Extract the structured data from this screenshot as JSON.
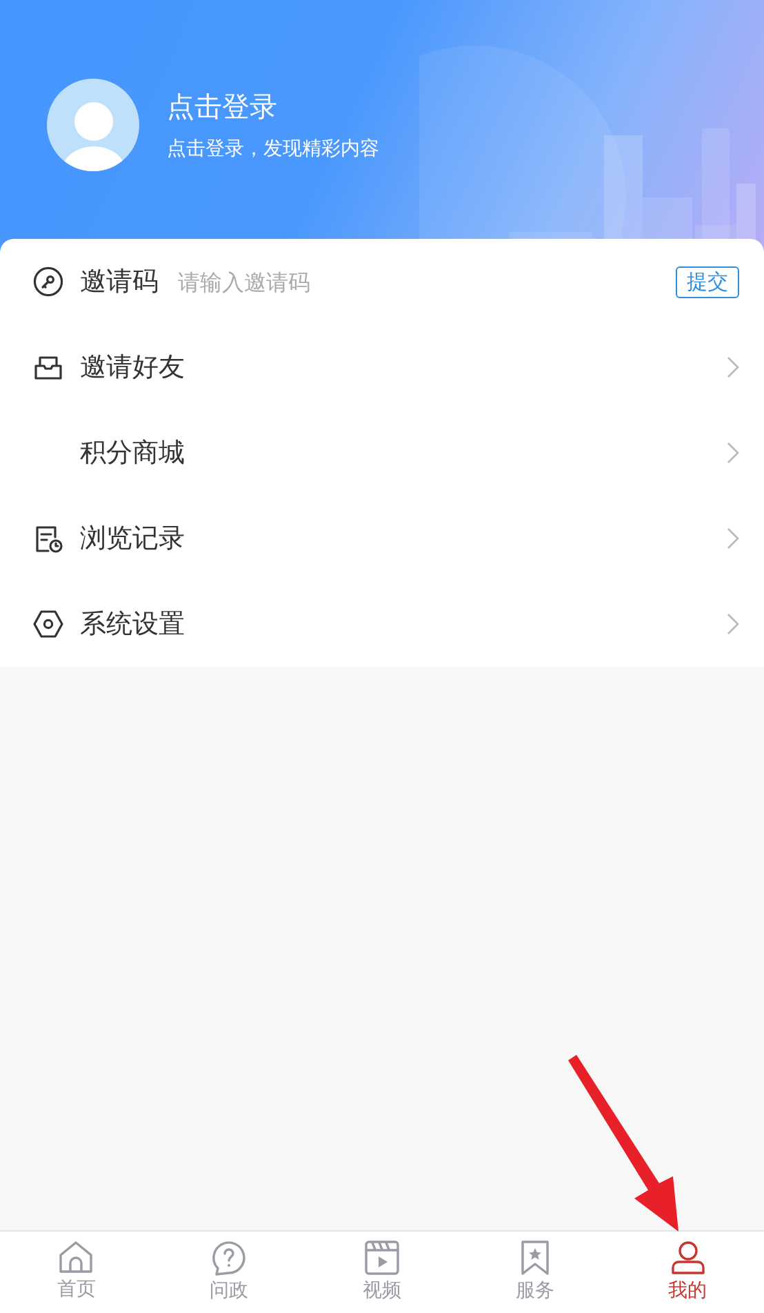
{
  "profile": {
    "title": "点击登录",
    "subtitle": "点击登录，发现精彩内容"
  },
  "invite_code": {
    "label": "邀请码",
    "placeholder": "请输入邀请码",
    "button": "提交"
  },
  "menu": [
    {
      "label": "邀请好友"
    },
    {
      "label": "积分商城"
    },
    {
      "label": "浏览记录"
    },
    {
      "label": "系统设置"
    }
  ],
  "tabs": [
    {
      "label": "首页",
      "selected": false
    },
    {
      "label": "问政",
      "selected": false
    },
    {
      "label": "视频",
      "selected": false
    },
    {
      "label": "服务",
      "selected": false
    },
    {
      "label": "我的",
      "selected": true
    }
  ]
}
